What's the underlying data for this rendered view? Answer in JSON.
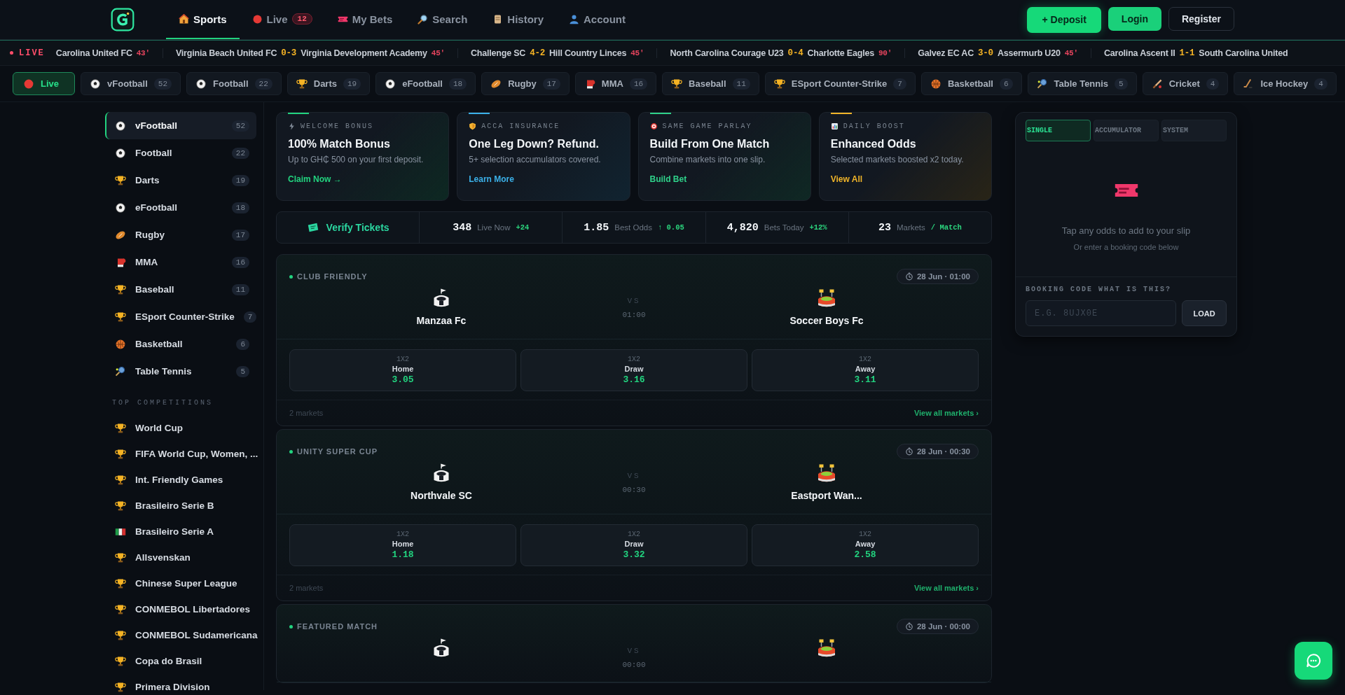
{
  "header": {
    "nav": [
      {
        "label": "Sports",
        "kind": "house",
        "selected": true
      },
      {
        "label": "Live",
        "kind": "live",
        "selected": false,
        "badge": "12"
      },
      {
        "label": "My Bets",
        "kind": "ticket",
        "selected": false
      },
      {
        "label": "Search",
        "kind": "search",
        "selected": false
      },
      {
        "label": "History",
        "kind": "scroll",
        "selected": false
      },
      {
        "label": "Account",
        "kind": "person",
        "selected": false
      }
    ],
    "buttons": [
      {
        "label": "+ Deposit",
        "kind": "primary"
      },
      {
        "label": "Login",
        "kind": "secondary"
      },
      {
        "label": "Register",
        "kind": "outline"
      }
    ]
  },
  "ticker": {
    "label": "LIVE",
    "items": [
      {
        "away": "Carolina United FC",
        "minute": "43'"
      },
      {
        "home": "Virginia Beach United FC",
        "score": "0-3",
        "away": "Virginia Development Academy",
        "minute": "45'"
      },
      {
        "home": "Challenge SC",
        "score": "4-2",
        "away": "Hill Country Linces",
        "minute": "45'"
      },
      {
        "home": "North Carolina Courage U23",
        "score": "0-4",
        "away": "Charlotte Eagles",
        "minute": "90'"
      },
      {
        "home": "Galvez EC AC",
        "score": "3-0",
        "away": "Assermurb U20",
        "minute": "45'"
      },
      {
        "home": "Carolina Ascent II",
        "score": "1-1",
        "away": "South Carolina United"
      }
    ]
  },
  "sport_chips": [
    {
      "label": "Live",
      "kind": "live",
      "selected": true
    },
    {
      "label": "vFootball",
      "kind": "football",
      "count": "52",
      "selected": false
    },
    {
      "label": "Football",
      "kind": "football",
      "count": "22",
      "selected": false
    },
    {
      "label": "Darts",
      "kind": "trophy",
      "count": "19",
      "selected": false
    },
    {
      "label": "eFootball",
      "kind": "football",
      "count": "18",
      "selected": false
    },
    {
      "label": "Rugby",
      "kind": "rugby",
      "count": "17",
      "selected": false
    },
    {
      "label": "MMA",
      "kind": "glove",
      "count": "16",
      "selected": false
    },
    {
      "label": "Baseball",
      "kind": "trophy",
      "count": "11",
      "selected": false
    },
    {
      "label": "ESport Counter-Strike",
      "kind": "trophy",
      "count": "7",
      "selected": false
    },
    {
      "label": "Basketball",
      "kind": "basketball",
      "count": "6",
      "selected": false
    },
    {
      "label": "Table Tennis",
      "kind": "tennis",
      "count": "5",
      "selected": false
    },
    {
      "label": "Cricket",
      "kind": "cricket",
      "count": "4",
      "selected": false
    },
    {
      "label": "Ice Hockey",
      "kind": "hockey",
      "count": "4",
      "selected": false
    }
  ],
  "sidebar": {
    "sports": [
      {
        "label": "vFootball",
        "kind": "football",
        "count": "52",
        "selected": true
      },
      {
        "label": "Football",
        "kind": "football",
        "count": "22",
        "selected": false
      },
      {
        "label": "Darts",
        "kind": "trophy",
        "count": "19",
        "selected": false
      },
      {
        "label": "eFootball",
        "kind": "football",
        "count": "18",
        "selected": false
      },
      {
        "label": "Rugby",
        "kind": "rugby",
        "count": "17",
        "selected": false
      },
      {
        "label": "MMA",
        "kind": "glove",
        "count": "16",
        "selected": false
      },
      {
        "label": "Baseball",
        "kind": "trophy",
        "count": "11",
        "selected": false
      },
      {
        "label": "ESport Counter-Strike",
        "kind": "trophy",
        "count": "7",
        "selected": false
      },
      {
        "label": "Basketball",
        "kind": "basketball",
        "count": "6",
        "selected": false
      },
      {
        "label": "Table Tennis",
        "kind": "tennis",
        "count": "5",
        "selected": false
      }
    ],
    "competitions_title": "TOP COMPETITIONS",
    "competitions": [
      {
        "label": "World Cup",
        "kind": "trophy"
      },
      {
        "label": "FIFA World Cup, Women, ...",
        "kind": "trophy"
      },
      {
        "label": "Int. Friendly Games",
        "kind": "trophy"
      },
      {
        "label": "Brasileiro Serie B",
        "kind": "trophy"
      },
      {
        "label": "Brasileiro Serie A",
        "kind": "flag"
      },
      {
        "label": "Allsvenskan",
        "kind": "trophy"
      },
      {
        "label": "Chinese Super League",
        "kind": "trophy"
      },
      {
        "label": "CONMEBOL Libertadores",
        "kind": "trophy"
      },
      {
        "label": "CONMEBOL Sudamericana",
        "kind": "trophy"
      },
      {
        "label": "Copa do Brasil",
        "kind": "trophy"
      },
      {
        "label": "Primera Division",
        "kind": "trophy"
      }
    ]
  },
  "promos": [
    {
      "kind": "bolt",
      "tag": "WELCOME BONUS",
      "title": "100% Match Bonus",
      "text": "Up to GH₵ 500 on your first deposit.",
      "link": "Claim Now →",
      "color": "#22d37f"
    },
    {
      "kind": "shield",
      "tag": "ACCA INSURANCE",
      "title": "One Leg Down? Refund.",
      "text": "5+ selection accumulators covered.",
      "link": "Learn More",
      "color": "#3bb0e8"
    },
    {
      "kind": "target",
      "tag": "SAME GAME PARLAY",
      "title": "Build From One Match",
      "text": "Combine markets into one slip.",
      "link": "Build Bet",
      "color": "#2fd18a"
    },
    {
      "kind": "chart",
      "tag": "DAILY BOOST",
      "title": "Enhanced Odds",
      "text": "Selected markets boosted x2 today.",
      "link": "View All",
      "color": "#f0b429"
    }
  ],
  "stats": {
    "verify": "Verify Tickets",
    "items": [
      {
        "value": "348",
        "label": "Live Now",
        "delta": "+24"
      },
      {
        "value": "1.85",
        "label": "Best Odds",
        "delta": "↑ 0.05"
      },
      {
        "value": "4,820",
        "label": "Bets Today",
        "delta": "+12%"
      },
      {
        "value": "23",
        "label": "Markets",
        "delta": "/ Match"
      }
    ]
  },
  "matches": [
    {
      "league": "CLUB FRIENDLY",
      "time": "28 Jun · 01:00",
      "vs": "VS",
      "kickoff": "01:00",
      "home": "Manzaa Fc",
      "away": "Soccer Boys Fc",
      "odds": [
        {
          "market": "1X2",
          "label": "Home",
          "value": "3.05"
        },
        {
          "market": "1X2",
          "label": "Draw",
          "value": "3.16"
        },
        {
          "market": "1X2",
          "label": "Away",
          "value": "3.11"
        }
      ],
      "markets": "2 markets",
      "more": "View all markets ›"
    },
    {
      "league": "UNITY SUPER CUP",
      "time": "28 Jun · 00:30",
      "vs": "VS",
      "kickoff": "00:30",
      "home": "Northvale SC",
      "away": "Eastport Wan...",
      "odds": [
        {
          "market": "1X2",
          "label": "Home",
          "value": "1.18"
        },
        {
          "market": "1X2",
          "label": "Draw",
          "value": "3.32"
        },
        {
          "market": "1X2",
          "label": "Away",
          "value": "2.58"
        }
      ],
      "markets": "2 markets",
      "more": "View all markets ›"
    },
    {
      "league": "FEATURED MATCH",
      "time": "28 Jun · 00:00",
      "vs": "VS",
      "kickoff": "00:00"
    }
  ],
  "bet_slip": {
    "tabs": [
      {
        "label": "SINGLE",
        "selected": true
      },
      {
        "label": "ACCUMULATOR",
        "selected": false
      },
      {
        "label": "SYSTEM",
        "selected": false
      }
    ],
    "empty_title": "Tap any odds to add to your slip",
    "empty_hint": "Or enter a booking code below",
    "booking_label": "BOOKING CODE WHAT IS THIS?",
    "placeholder": "E.G. 8UJX0E",
    "load": "LOAD"
  }
}
